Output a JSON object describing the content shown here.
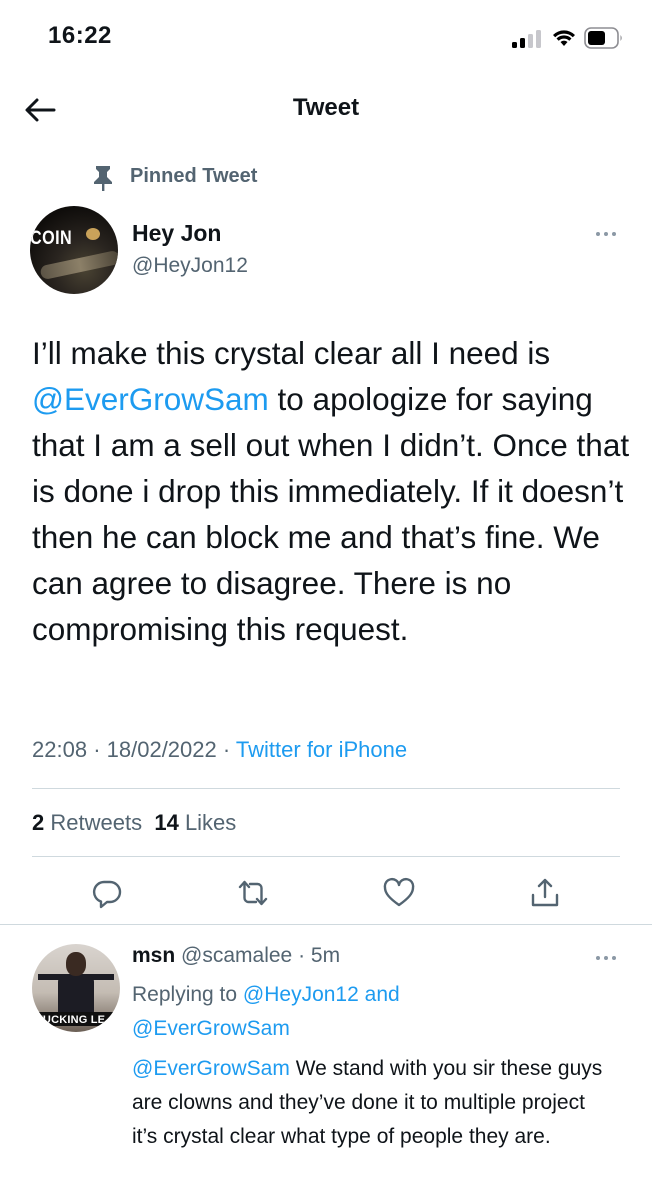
{
  "status_bar": {
    "time": "16:22"
  },
  "header": {
    "title": "Tweet",
    "back_icon": "arrow-left-icon"
  },
  "pinned_label": "Pinned Tweet",
  "tweet": {
    "author_name": "Hey Jon",
    "author_handle": "@HeyJon12",
    "avatar_text": "COIN",
    "text_before": "I’ll make this crystal clear all I need is ",
    "mention": "@EverGrowSam",
    "text_after": " to apologize for saying that I am a sell out when I didn’t. Once that is done i drop this immediately. If it doesn’t then he can block me and that’s fine. We can agree to disagree. There is no compromising this request.",
    "time": "22:08",
    "date": "18/02/2022",
    "separator": "·",
    "source": "Twitter for iPhone",
    "retweet_count": "2",
    "retweet_label": "Retweets",
    "like_count": "14",
    "like_label": "Likes"
  },
  "actions": [
    "reply-icon",
    "retweet-icon",
    "like-icon",
    "share-icon"
  ],
  "reply": {
    "name": "msn",
    "handle": "@scamalee",
    "separator": "·",
    "age": "5m",
    "avatar_text": "FUCKING LE",
    "replying_prefix": "Replying to",
    "replying_to_1": "@HeyJon12",
    "replying_and": "and",
    "replying_to_2": "@EverGrowSam",
    "mention": "@EverGrowSam",
    "text": " We stand with you sir these guys are clowns and they’ve done it to multiple project it’s crystal clear what type of people they are."
  },
  "colors": {
    "accent": "#1d9bf0",
    "secondary_text": "#536471",
    "divider": "#cfd9de"
  }
}
